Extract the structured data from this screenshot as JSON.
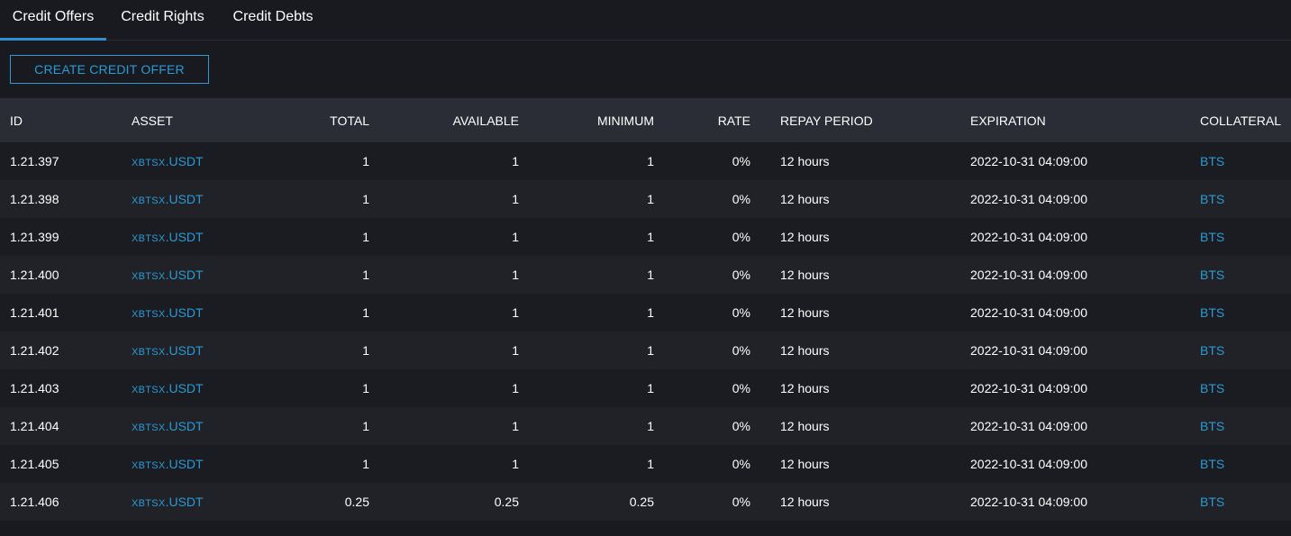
{
  "tabs": [
    {
      "label": "Credit Offers",
      "active": true
    },
    {
      "label": "Credit Rights",
      "active": false
    },
    {
      "label": "Credit Debts",
      "active": false
    }
  ],
  "toolbar": {
    "create_label": "CREATE CREDIT OFFER"
  },
  "colors": {
    "accent": "#2a9bd4",
    "tab_underline": "#2f8fd0",
    "background": "#191a1f",
    "header_row": "#2a2d35"
  },
  "table": {
    "columns": [
      "ID",
      "ASSET",
      "TOTAL",
      "AVAILABLE",
      "MINIMUM",
      "RATE",
      "REPAY PERIOD",
      "EXPIRATION",
      "COLLATERAL"
    ],
    "rows": [
      {
        "id": "1.21.397",
        "asset_prefix": "XBTSX",
        "asset_suffix": ".USDT",
        "total": "1",
        "available": "1",
        "minimum": "1",
        "rate": "0%",
        "repay": "12 hours",
        "expiration": "2022-10-31 04:09:00",
        "collateral": "BTS"
      },
      {
        "id": "1.21.398",
        "asset_prefix": "XBTSX",
        "asset_suffix": ".USDT",
        "total": "1",
        "available": "1",
        "minimum": "1",
        "rate": "0%",
        "repay": "12 hours",
        "expiration": "2022-10-31 04:09:00",
        "collateral": "BTS"
      },
      {
        "id": "1.21.399",
        "asset_prefix": "XBTSX",
        "asset_suffix": ".USDT",
        "total": "1",
        "available": "1",
        "minimum": "1",
        "rate": "0%",
        "repay": "12 hours",
        "expiration": "2022-10-31 04:09:00",
        "collateral": "BTS"
      },
      {
        "id": "1.21.400",
        "asset_prefix": "XBTSX",
        "asset_suffix": ".USDT",
        "total": "1",
        "available": "1",
        "minimum": "1",
        "rate": "0%",
        "repay": "12 hours",
        "expiration": "2022-10-31 04:09:00",
        "collateral": "BTS"
      },
      {
        "id": "1.21.401",
        "asset_prefix": "XBTSX",
        "asset_suffix": ".USDT",
        "total": "1",
        "available": "1",
        "minimum": "1",
        "rate": "0%",
        "repay": "12 hours",
        "expiration": "2022-10-31 04:09:00",
        "collateral": "BTS"
      },
      {
        "id": "1.21.402",
        "asset_prefix": "XBTSX",
        "asset_suffix": ".USDT",
        "total": "1",
        "available": "1",
        "minimum": "1",
        "rate": "0%",
        "repay": "12 hours",
        "expiration": "2022-10-31 04:09:00",
        "collateral": "BTS"
      },
      {
        "id": "1.21.403",
        "asset_prefix": "XBTSX",
        "asset_suffix": ".USDT",
        "total": "1",
        "available": "1",
        "minimum": "1",
        "rate": "0%",
        "repay": "12 hours",
        "expiration": "2022-10-31 04:09:00",
        "collateral": "BTS"
      },
      {
        "id": "1.21.404",
        "asset_prefix": "XBTSX",
        "asset_suffix": ".USDT",
        "total": "1",
        "available": "1",
        "minimum": "1",
        "rate": "0%",
        "repay": "12 hours",
        "expiration": "2022-10-31 04:09:00",
        "collateral": "BTS"
      },
      {
        "id": "1.21.405",
        "asset_prefix": "XBTSX",
        "asset_suffix": ".USDT",
        "total": "1",
        "available": "1",
        "minimum": "1",
        "rate": "0%",
        "repay": "12 hours",
        "expiration": "2022-10-31 04:09:00",
        "collateral": "BTS"
      },
      {
        "id": "1.21.406",
        "asset_prefix": "XBTSX",
        "asset_suffix": ".USDT",
        "total": "0.25",
        "available": "0.25",
        "minimum": "0.25",
        "rate": "0%",
        "repay": "12 hours",
        "expiration": "2022-10-31 04:09:00",
        "collateral": "BTS"
      }
    ]
  }
}
